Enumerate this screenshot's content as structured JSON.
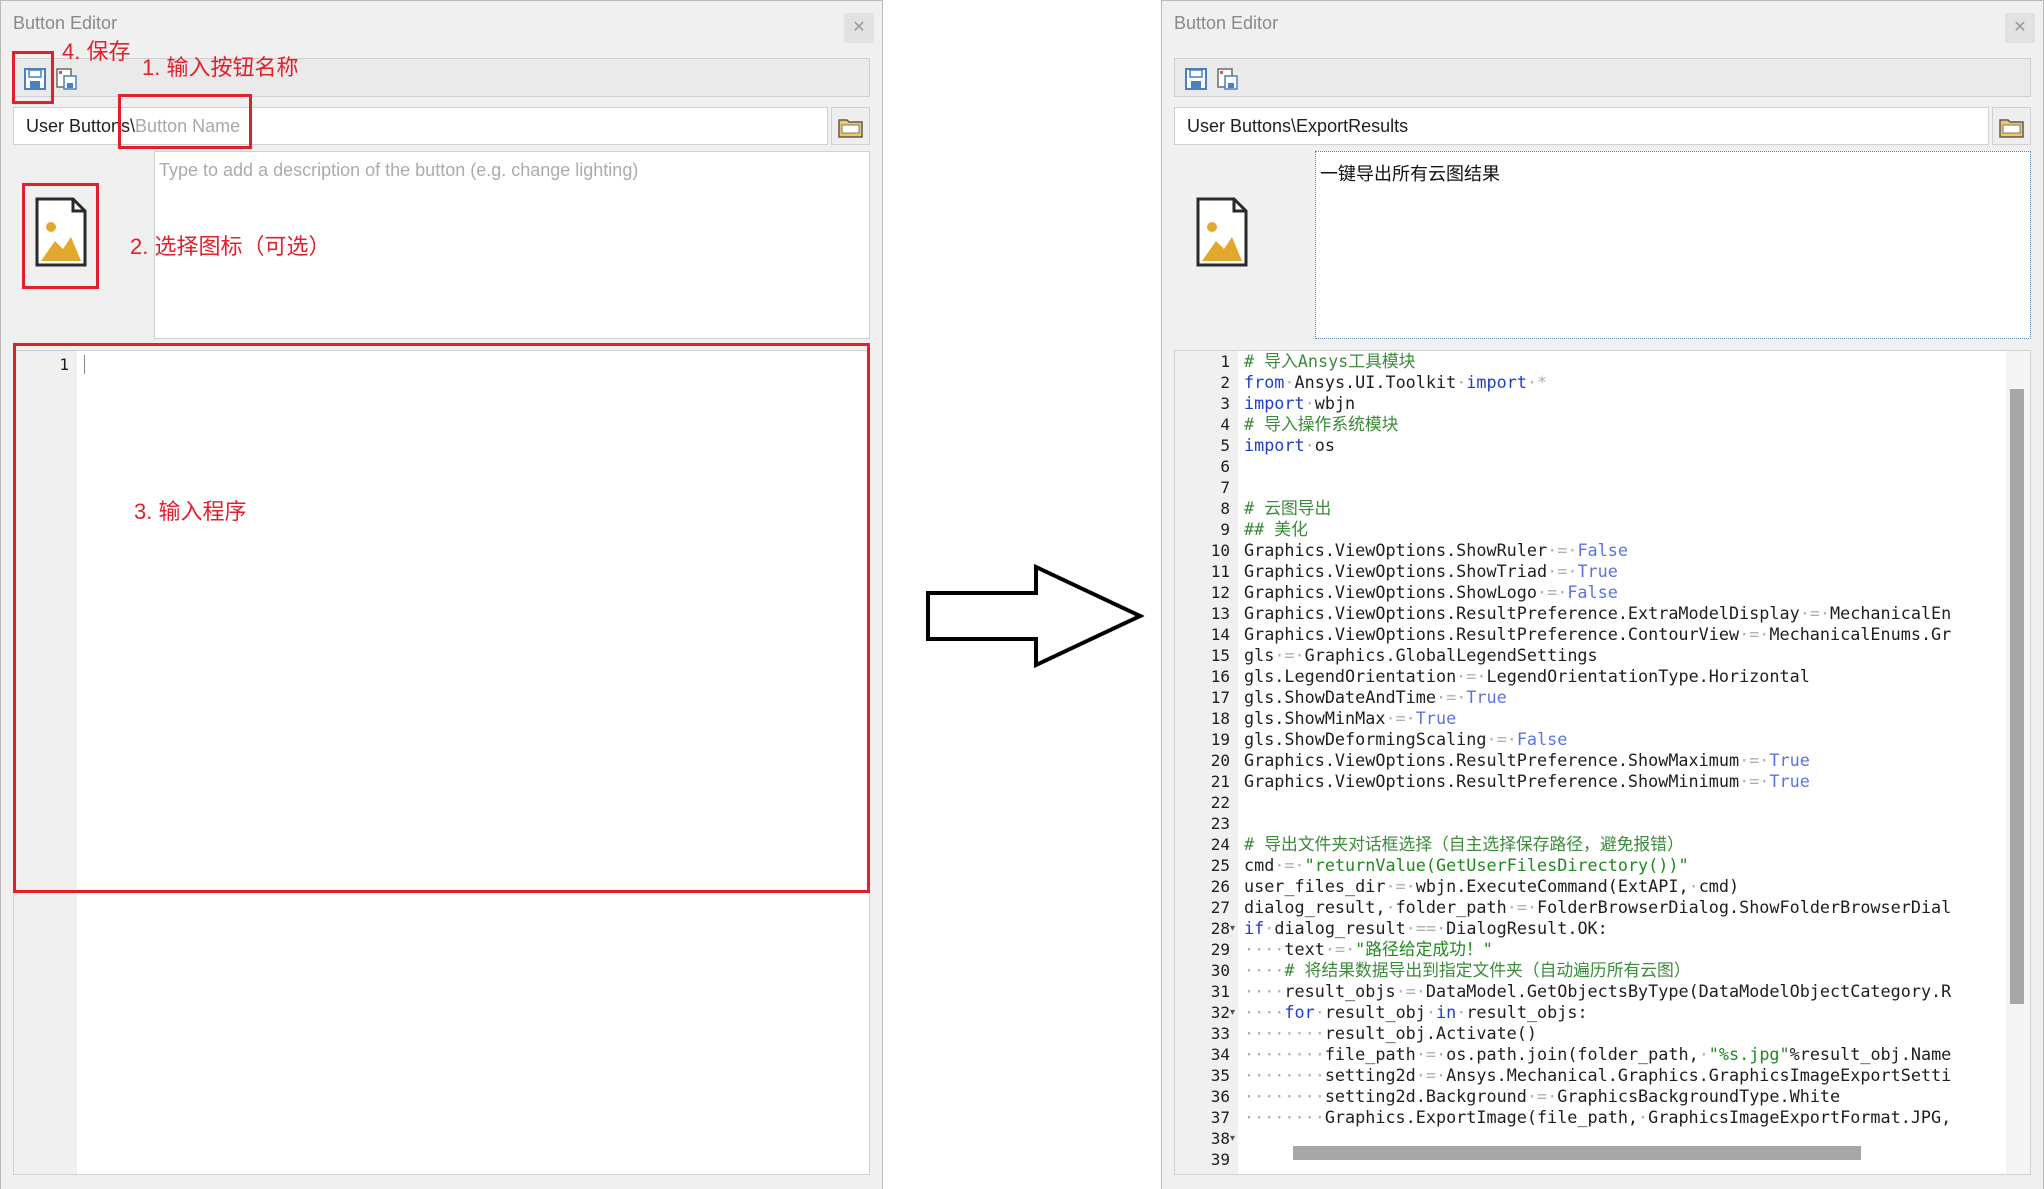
{
  "annotations": {
    "save": "4. 保存",
    "name": "1. 输入按钮名称",
    "icon": "2. 选择图标（可选）",
    "program": "3. 输入程序"
  },
  "left_dialog": {
    "title": "Button Editor",
    "path_prefix": "User Buttons\\",
    "name_placeholder": "Button Name",
    "description_placeholder": "Type to add a description of the button (e.g. change lighting)",
    "line_number": "1"
  },
  "right_dialog": {
    "title": "Button Editor",
    "path": "User Buttons\\ExportResults",
    "description": "一键导出所有云图结果",
    "line_numbers": [
      "1",
      "2",
      "3",
      "4",
      "5",
      "6",
      "7",
      "8",
      "9",
      "10",
      "11",
      "12",
      "13",
      "14",
      "15",
      "16",
      "17",
      "18",
      "19",
      "20",
      "21",
      "22",
      "23",
      "24",
      "25",
      "26",
      "27",
      "28",
      "29",
      "30",
      "31",
      "32",
      "33",
      "34",
      "35",
      "36",
      "37",
      "38",
      "39"
    ],
    "code_lines": [
      "# 导入Ansys工具模块",
      "from Ansys.UI.Toolkit import *",
      "import wbjn",
      "# 导入操作系统模块",
      "import os",
      "",
      "",
      "# 云图导出",
      "## 美化",
      "Graphics.ViewOptions.ShowRuler = False",
      "Graphics.ViewOptions.ShowTriad = True",
      "Graphics.ViewOptions.ShowLogo = False",
      "Graphics.ViewOptions.ResultPreference.ExtraModelDisplay = MechanicalEn",
      "Graphics.ViewOptions.ResultPreference.ContourView = MechanicalEnums.Gr",
      "gls = Graphics.GlobalLegendSettings",
      "gls.LegendOrientation = LegendOrientationType.Horizontal",
      "gls.ShowDateAndTime = True",
      "gls.ShowMinMax = True",
      "gls.ShowDeformingScaling = False",
      "Graphics.ViewOptions.ResultPreference.ShowMaximum = True",
      "Graphics.ViewOptions.ResultPreference.ShowMinimum = True",
      "",
      "",
      "# 导出文件夹对话框选择（自主选择保存路径，避免报错）",
      "cmd = \"returnValue(GetUserFilesDirectory())\"",
      "user_files_dir = wbjn.ExecuteCommand(ExtAPI, cmd)",
      "dialog_result, folder_path = FolderBrowserDialog.ShowFolderBrowserDial",
      "if dialog_result == DialogResult.OK:",
      "    text = \"路径给定成功！\"",
      "    # 将结果数据导出到指定文件夹（自动遍历所有云图）",
      "    result_objs = DataModel.GetObjectsByType(DataModelObjectCategory.R",
      "    for result_obj in result_objs:",
      "        result_obj.Activate()",
      "        file_path = os.path.join(folder_path, \"%s.jpg\"%result_obj.Name",
      "        setting2d = Ansys.Mechanical.Graphics.GraphicsImageExportSetti",
      "        setting2d.Background = GraphicsBackgroundType.White",
      "        Graphics.ExportImage(file_path, GraphicsImageExportFormat.JPG,",
      "",
      ""
    ]
  },
  "colors": {
    "annotation": "#e0202a",
    "comment": "#3b8b3b",
    "keyword": "#1f3fc8",
    "literal": "#5b73e0",
    "string": "#1e8a1e"
  }
}
